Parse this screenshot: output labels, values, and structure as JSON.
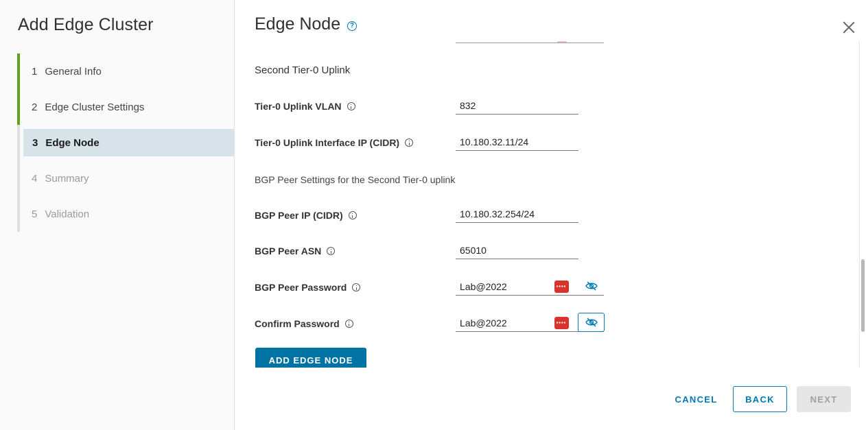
{
  "wizard": {
    "title": "Add Edge Cluster",
    "steps": [
      {
        "num": "1",
        "label": "General Info",
        "state": "done"
      },
      {
        "num": "2",
        "label": "Edge Cluster Settings",
        "state": "done"
      },
      {
        "num": "3",
        "label": "Edge Node",
        "state": "active"
      },
      {
        "num": "4",
        "label": "Summary",
        "state": "future"
      },
      {
        "num": "5",
        "label": "Validation",
        "state": "future"
      }
    ]
  },
  "page": {
    "title": "Edge Node",
    "section_second_uplink": "Second Tier-0 Uplink",
    "bgp_section": "BGP Peer Settings for the Second Tier-0 uplink",
    "fields": {
      "uplink_vlan": {
        "label": "Tier-0 Uplink VLAN",
        "value": "832"
      },
      "uplink_ip": {
        "label": "Tier-0 Uplink Interface IP (CIDR)",
        "value": "10.180.32.11/24"
      },
      "bgp_peer_ip": {
        "label": "BGP Peer IP (CIDR)",
        "value": "10.180.32.254/24"
      },
      "bgp_peer_asn": {
        "label": "BGP Peer ASN",
        "value": "65010"
      },
      "bgp_peer_password": {
        "label": "BGP Peer Password",
        "value": "Lab@2022"
      },
      "confirm_password": {
        "label": "Confirm Password",
        "value": "Lab@2022"
      }
    },
    "add_node_label": "ADD EDGE NODE"
  },
  "footer": {
    "cancel_label": "CANCEL",
    "back_label": "BACK",
    "next_label": "NEXT"
  },
  "colors": {
    "accent": "#0079b8",
    "step_done": "#5aa220",
    "active_step_bg": "#d8e3e9",
    "password_badge": "#d9342b"
  }
}
